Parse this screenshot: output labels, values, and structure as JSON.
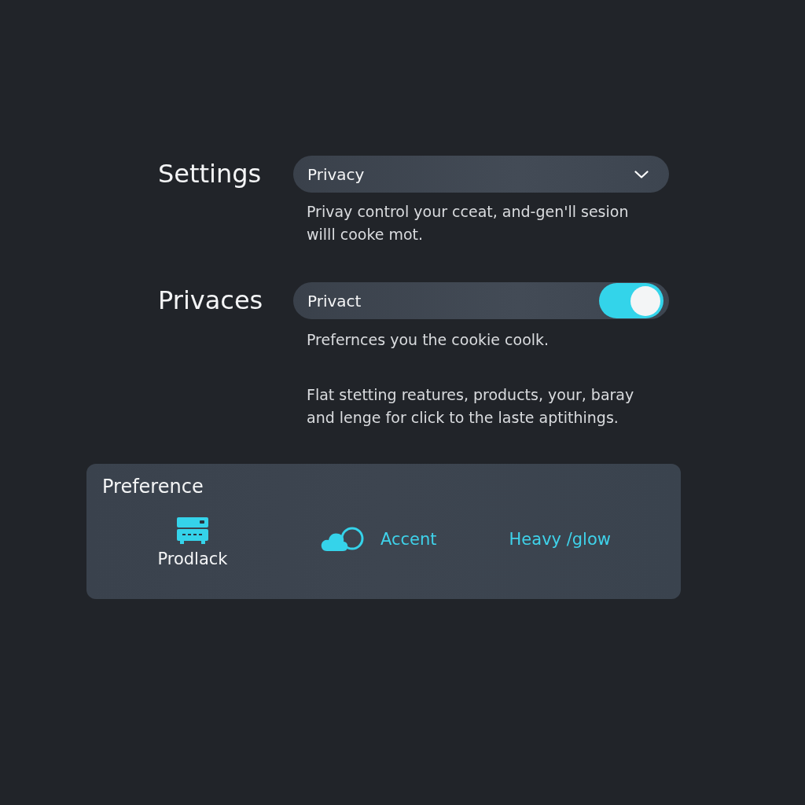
{
  "rows": [
    {
      "label": "Settings",
      "kind": "dropdown",
      "value": "Privacy",
      "descriptions": [
        "Privay control your cceat, and-gen'll sesion willl cooke mot."
      ]
    },
    {
      "label": "Privaces",
      "kind": "toggle",
      "value": "Privact",
      "on": true,
      "descriptions": [
        "Prefernces you the cookie coolk.",
        "Flat stetting reatures, products, your, baray and lenge for click to the laste aptithings."
      ]
    }
  ],
  "preference_panel": {
    "title": "Preference",
    "items": [
      {
        "kind": "stacked",
        "label": "Prodlack"
      },
      {
        "kind": "inline",
        "label": "Accent"
      },
      {
        "kind": "text",
        "label": "Heavy /glow"
      }
    ]
  }
}
